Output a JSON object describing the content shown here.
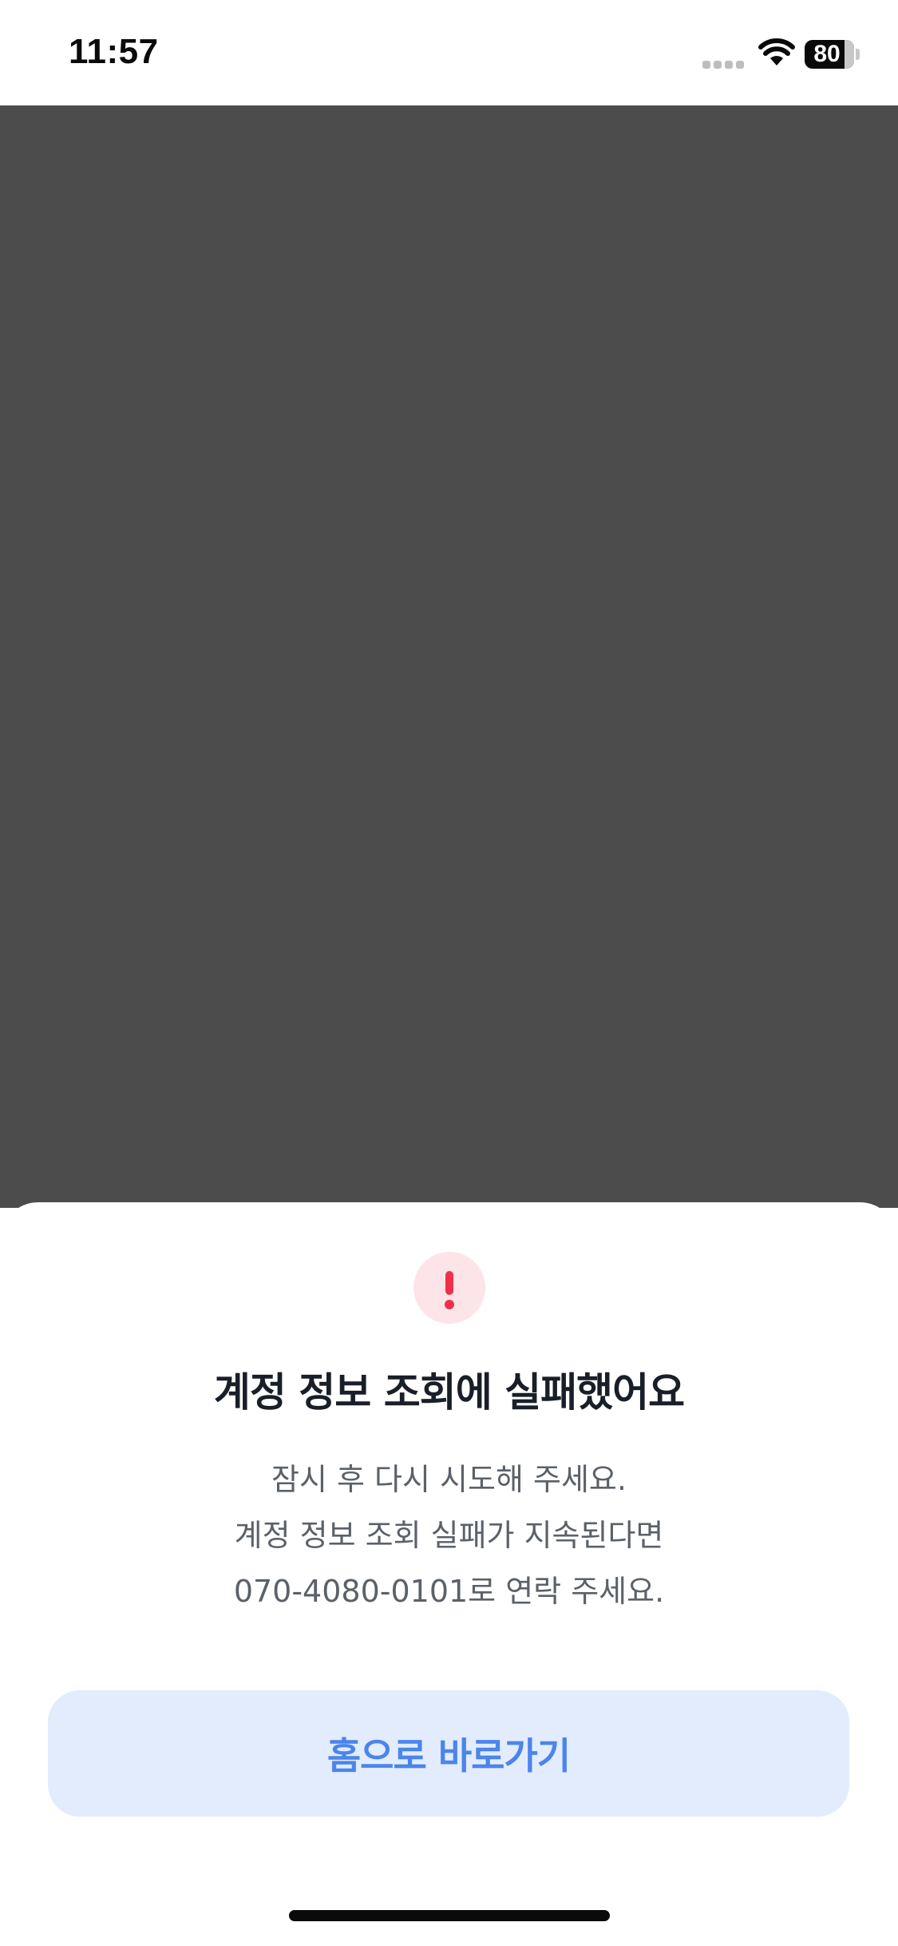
{
  "status_bar": {
    "time": "11:57",
    "battery": "80",
    "icons": [
      "cellular-signal-icon",
      "wifi-icon",
      "battery-icon"
    ]
  },
  "dialog": {
    "icon": "exclamation-icon",
    "title": "계정 정보 조회에 실패했어요",
    "message_lines": [
      "잠시 후 다시 시도해 주세요.",
      "계정 정보 조회 실패가 지속된다면",
      "070-4080-0101로 연락 주세요."
    ],
    "button_label": "홈으로 바로가기"
  },
  "colors": {
    "overlay": "#4c4c4c",
    "alert_red": "#f0304a",
    "alert_badge_bg": "#fde4e8",
    "button_bg": "#e2ecfc",
    "button_text": "#4b84ec",
    "title_text": "#191f28",
    "body_text": "#5b6169"
  }
}
